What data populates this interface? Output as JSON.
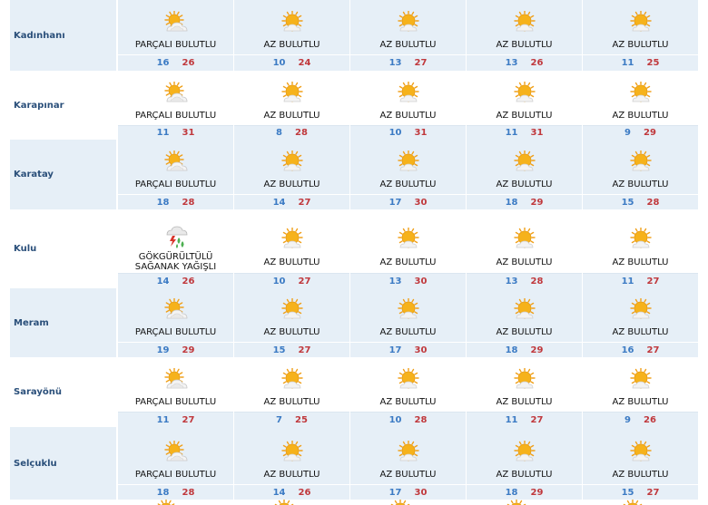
{
  "rows": [
    {
      "city": "Kadınhanı",
      "days": [
        {
          "icon": "partly-cloudy-icon",
          "condition": [
            "PARÇALI BULUTLU"
          ],
          "min": "16",
          "max": "26"
        },
        {
          "icon": "mostly-sunny-icon",
          "condition": [
            "AZ BULUTLU"
          ],
          "min": "10",
          "max": "24"
        },
        {
          "icon": "mostly-sunny-icon",
          "condition": [
            "AZ BULUTLU"
          ],
          "min": "13",
          "max": "27"
        },
        {
          "icon": "mostly-sunny-icon",
          "condition": [
            "AZ BULUTLU"
          ],
          "min": "13",
          "max": "26"
        },
        {
          "icon": "mostly-sunny-icon",
          "condition": [
            "AZ BULUTLU"
          ],
          "min": "11",
          "max": "25"
        }
      ]
    },
    {
      "city": "Karapınar",
      "days": [
        {
          "icon": "partly-cloudy-icon",
          "condition": [
            "PARÇALI BULUTLU"
          ],
          "min": "11",
          "max": "31"
        },
        {
          "icon": "mostly-sunny-icon",
          "condition": [
            "AZ BULUTLU"
          ],
          "min": "8",
          "max": "28"
        },
        {
          "icon": "mostly-sunny-icon",
          "condition": [
            "AZ BULUTLU"
          ],
          "min": "10",
          "max": "31"
        },
        {
          "icon": "mostly-sunny-icon",
          "condition": [
            "AZ BULUTLU"
          ],
          "min": "11",
          "max": "31"
        },
        {
          "icon": "mostly-sunny-icon",
          "condition": [
            "AZ BULUTLU"
          ],
          "min": "9",
          "max": "29"
        }
      ]
    },
    {
      "city": "Karatay",
      "days": [
        {
          "icon": "partly-cloudy-icon",
          "condition": [
            "PARÇALI BULUTLU"
          ],
          "min": "18",
          "max": "28"
        },
        {
          "icon": "mostly-sunny-icon",
          "condition": [
            "AZ BULUTLU"
          ],
          "min": "14",
          "max": "27"
        },
        {
          "icon": "mostly-sunny-icon",
          "condition": [
            "AZ BULUTLU"
          ],
          "min": "17",
          "max": "30"
        },
        {
          "icon": "mostly-sunny-icon",
          "condition": [
            "AZ BULUTLU"
          ],
          "min": "18",
          "max": "29"
        },
        {
          "icon": "mostly-sunny-icon",
          "condition": [
            "AZ BULUTLU"
          ],
          "min": "15",
          "max": "28"
        }
      ]
    },
    {
      "city": "Kulu",
      "days": [
        {
          "icon": "thunderstorm-rain-icon",
          "condition": [
            "GÖKGÜRÜLTÜLÜ",
            "SAĞANAK YAĞIŞLI"
          ],
          "min": "14",
          "max": "26"
        },
        {
          "icon": "mostly-sunny-icon",
          "condition": [
            "AZ BULUTLU"
          ],
          "min": "10",
          "max": "27"
        },
        {
          "icon": "mostly-sunny-icon",
          "condition": [
            "AZ BULUTLU"
          ],
          "min": "13",
          "max": "30"
        },
        {
          "icon": "mostly-sunny-icon",
          "condition": [
            "AZ BULUTLU"
          ],
          "min": "13",
          "max": "28"
        },
        {
          "icon": "mostly-sunny-icon",
          "condition": [
            "AZ BULUTLU"
          ],
          "min": "11",
          "max": "27"
        }
      ]
    },
    {
      "city": "Meram",
      "days": [
        {
          "icon": "partly-cloudy-icon",
          "condition": [
            "PARÇALI BULUTLU"
          ],
          "min": "19",
          "max": "29"
        },
        {
          "icon": "mostly-sunny-icon",
          "condition": [
            "AZ BULUTLU"
          ],
          "min": "15",
          "max": "27"
        },
        {
          "icon": "mostly-sunny-icon",
          "condition": [
            "AZ BULUTLU"
          ],
          "min": "17",
          "max": "30"
        },
        {
          "icon": "mostly-sunny-icon",
          "condition": [
            "AZ BULUTLU"
          ],
          "min": "18",
          "max": "29"
        },
        {
          "icon": "mostly-sunny-icon",
          "condition": [
            "AZ BULUTLU"
          ],
          "min": "16",
          "max": "27"
        }
      ]
    },
    {
      "city": "Sarayönü",
      "days": [
        {
          "icon": "partly-cloudy-icon",
          "condition": [
            "PARÇALI BULUTLU"
          ],
          "min": "11",
          "max": "27"
        },
        {
          "icon": "mostly-sunny-icon",
          "condition": [
            "AZ BULUTLU"
          ],
          "min": "7",
          "max": "25"
        },
        {
          "icon": "mostly-sunny-icon",
          "condition": [
            "AZ BULUTLU"
          ],
          "min": "10",
          "max": "28"
        },
        {
          "icon": "mostly-sunny-icon",
          "condition": [
            "AZ BULUTLU"
          ],
          "min": "11",
          "max": "27"
        },
        {
          "icon": "mostly-sunny-icon",
          "condition": [
            "AZ BULUTLU"
          ],
          "min": "9",
          "max": "26"
        }
      ]
    },
    {
      "city": "Selçuklu",
      "days": [
        {
          "icon": "partly-cloudy-icon",
          "condition": [
            "PARÇALI BULUTLU"
          ],
          "min": "18",
          "max": "28"
        },
        {
          "icon": "mostly-sunny-icon",
          "condition": [
            "AZ BULUTLU"
          ],
          "min": "14",
          "max": "26"
        },
        {
          "icon": "mostly-sunny-icon",
          "condition": [
            "AZ BULUTLU"
          ],
          "min": "17",
          "max": "30"
        },
        {
          "icon": "mostly-sunny-icon",
          "condition": [
            "AZ BULUTLU"
          ],
          "min": "18",
          "max": "29"
        },
        {
          "icon": "mostly-sunny-icon",
          "condition": [
            "AZ BULUTLU"
          ],
          "min": "15",
          "max": "27"
        }
      ]
    }
  ],
  "peek_icons": [
    "partly-cloudy-icon",
    "mostly-sunny-icon",
    "mostly-sunny-icon",
    "mostly-sunny-icon",
    "mostly-sunny-icon"
  ],
  "colors": {
    "shade": "#e6eff7",
    "city": "#2a4f7a",
    "min": "#3c7bc4",
    "max": "#c0383c",
    "sun": "#f6b21b"
  }
}
